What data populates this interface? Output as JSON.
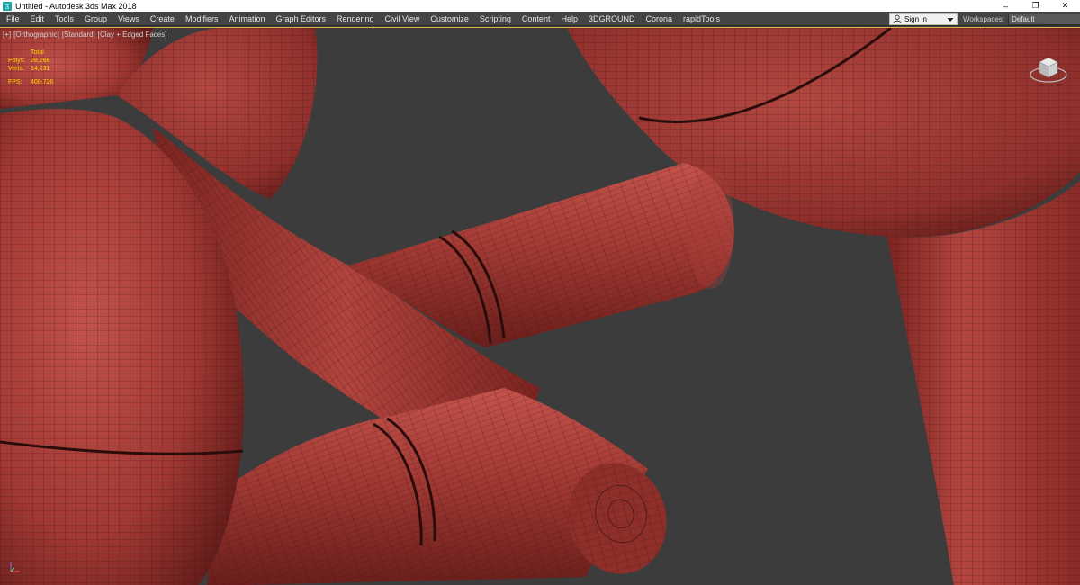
{
  "window": {
    "title": "Untitled - Autodesk 3ds Max 2018",
    "controls": {
      "minimize": "–",
      "restore": "❐",
      "close": "✕"
    }
  },
  "menubar": {
    "items": [
      "File",
      "Edit",
      "Tools",
      "Group",
      "Views",
      "Create",
      "Modifiers",
      "Animation",
      "Graph Editors",
      "Rendering",
      "Civil View",
      "Customize",
      "Scripting",
      "Content",
      "Help",
      "3DGROUND",
      "Corona",
      "rapidTools"
    ],
    "signin_label": "Sign In",
    "workspaces_label": "Workspaces:",
    "workspace_value": "Default"
  },
  "viewport": {
    "labels": [
      "[+]",
      "[Orthographic]",
      "[Standard]",
      "[Clay + Edged Faces]"
    ],
    "stats": {
      "header": "Total",
      "polys_label": "Polys:",
      "polys_value": "28,268",
      "verts_label": "Verts:",
      "verts_value": "14,231",
      "fps_label": "FPS:",
      "fps_value": "400.726"
    },
    "colors": {
      "background": "#3c3c3c",
      "clay": "#a63a34",
      "clay_light": "#c55650",
      "clay_dark": "#5e1a18",
      "wire": "#3a1210",
      "stats_text": "#ffd700"
    },
    "icons": [
      "viewcube-icon",
      "axis-tripod-icon"
    ]
  }
}
